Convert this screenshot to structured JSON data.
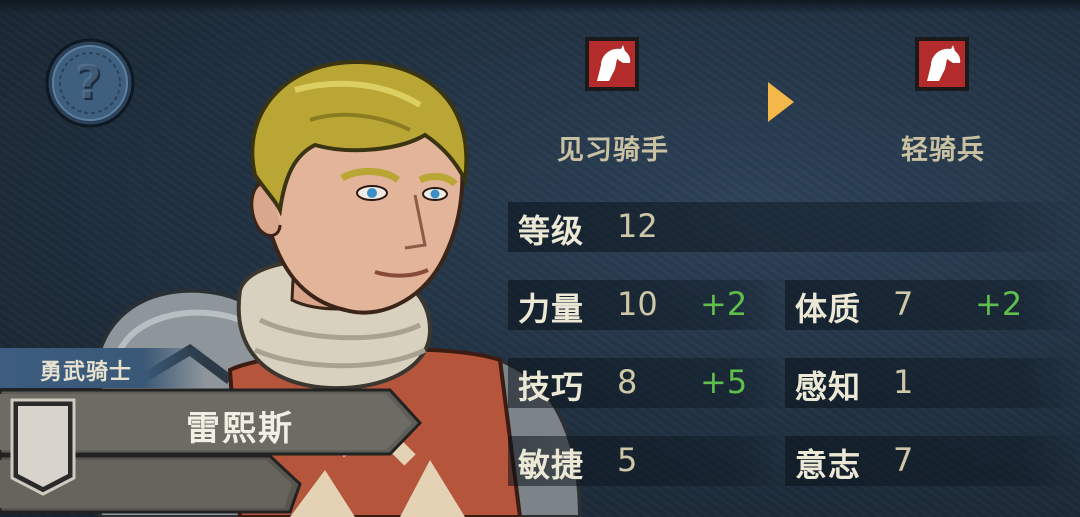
{
  "hero": {
    "title": "勇武骑士",
    "name": "雷熙斯"
  },
  "class_change": {
    "from": "见习骑手",
    "to": "轻骑兵",
    "icon": "horse-head-icon",
    "icon_color": "#b32b2b"
  },
  "stats": {
    "level": {
      "label": "等级",
      "value": "12"
    },
    "strength": {
      "label": "力量",
      "value": "10",
      "bonus": "+2"
    },
    "constitution": {
      "label": "体质",
      "value": "7",
      "bonus": "+2"
    },
    "skill": {
      "label": "技巧",
      "value": "8",
      "bonus": "+5"
    },
    "perception": {
      "label": "感知",
      "value": "1"
    },
    "agility": {
      "label": "敏捷",
      "value": "5"
    },
    "will": {
      "label": "意志",
      "value": "7"
    }
  },
  "colors": {
    "bonus": "#5fbf4d",
    "arrow": "#f3b74a",
    "title_band": "#3d5d80"
  }
}
